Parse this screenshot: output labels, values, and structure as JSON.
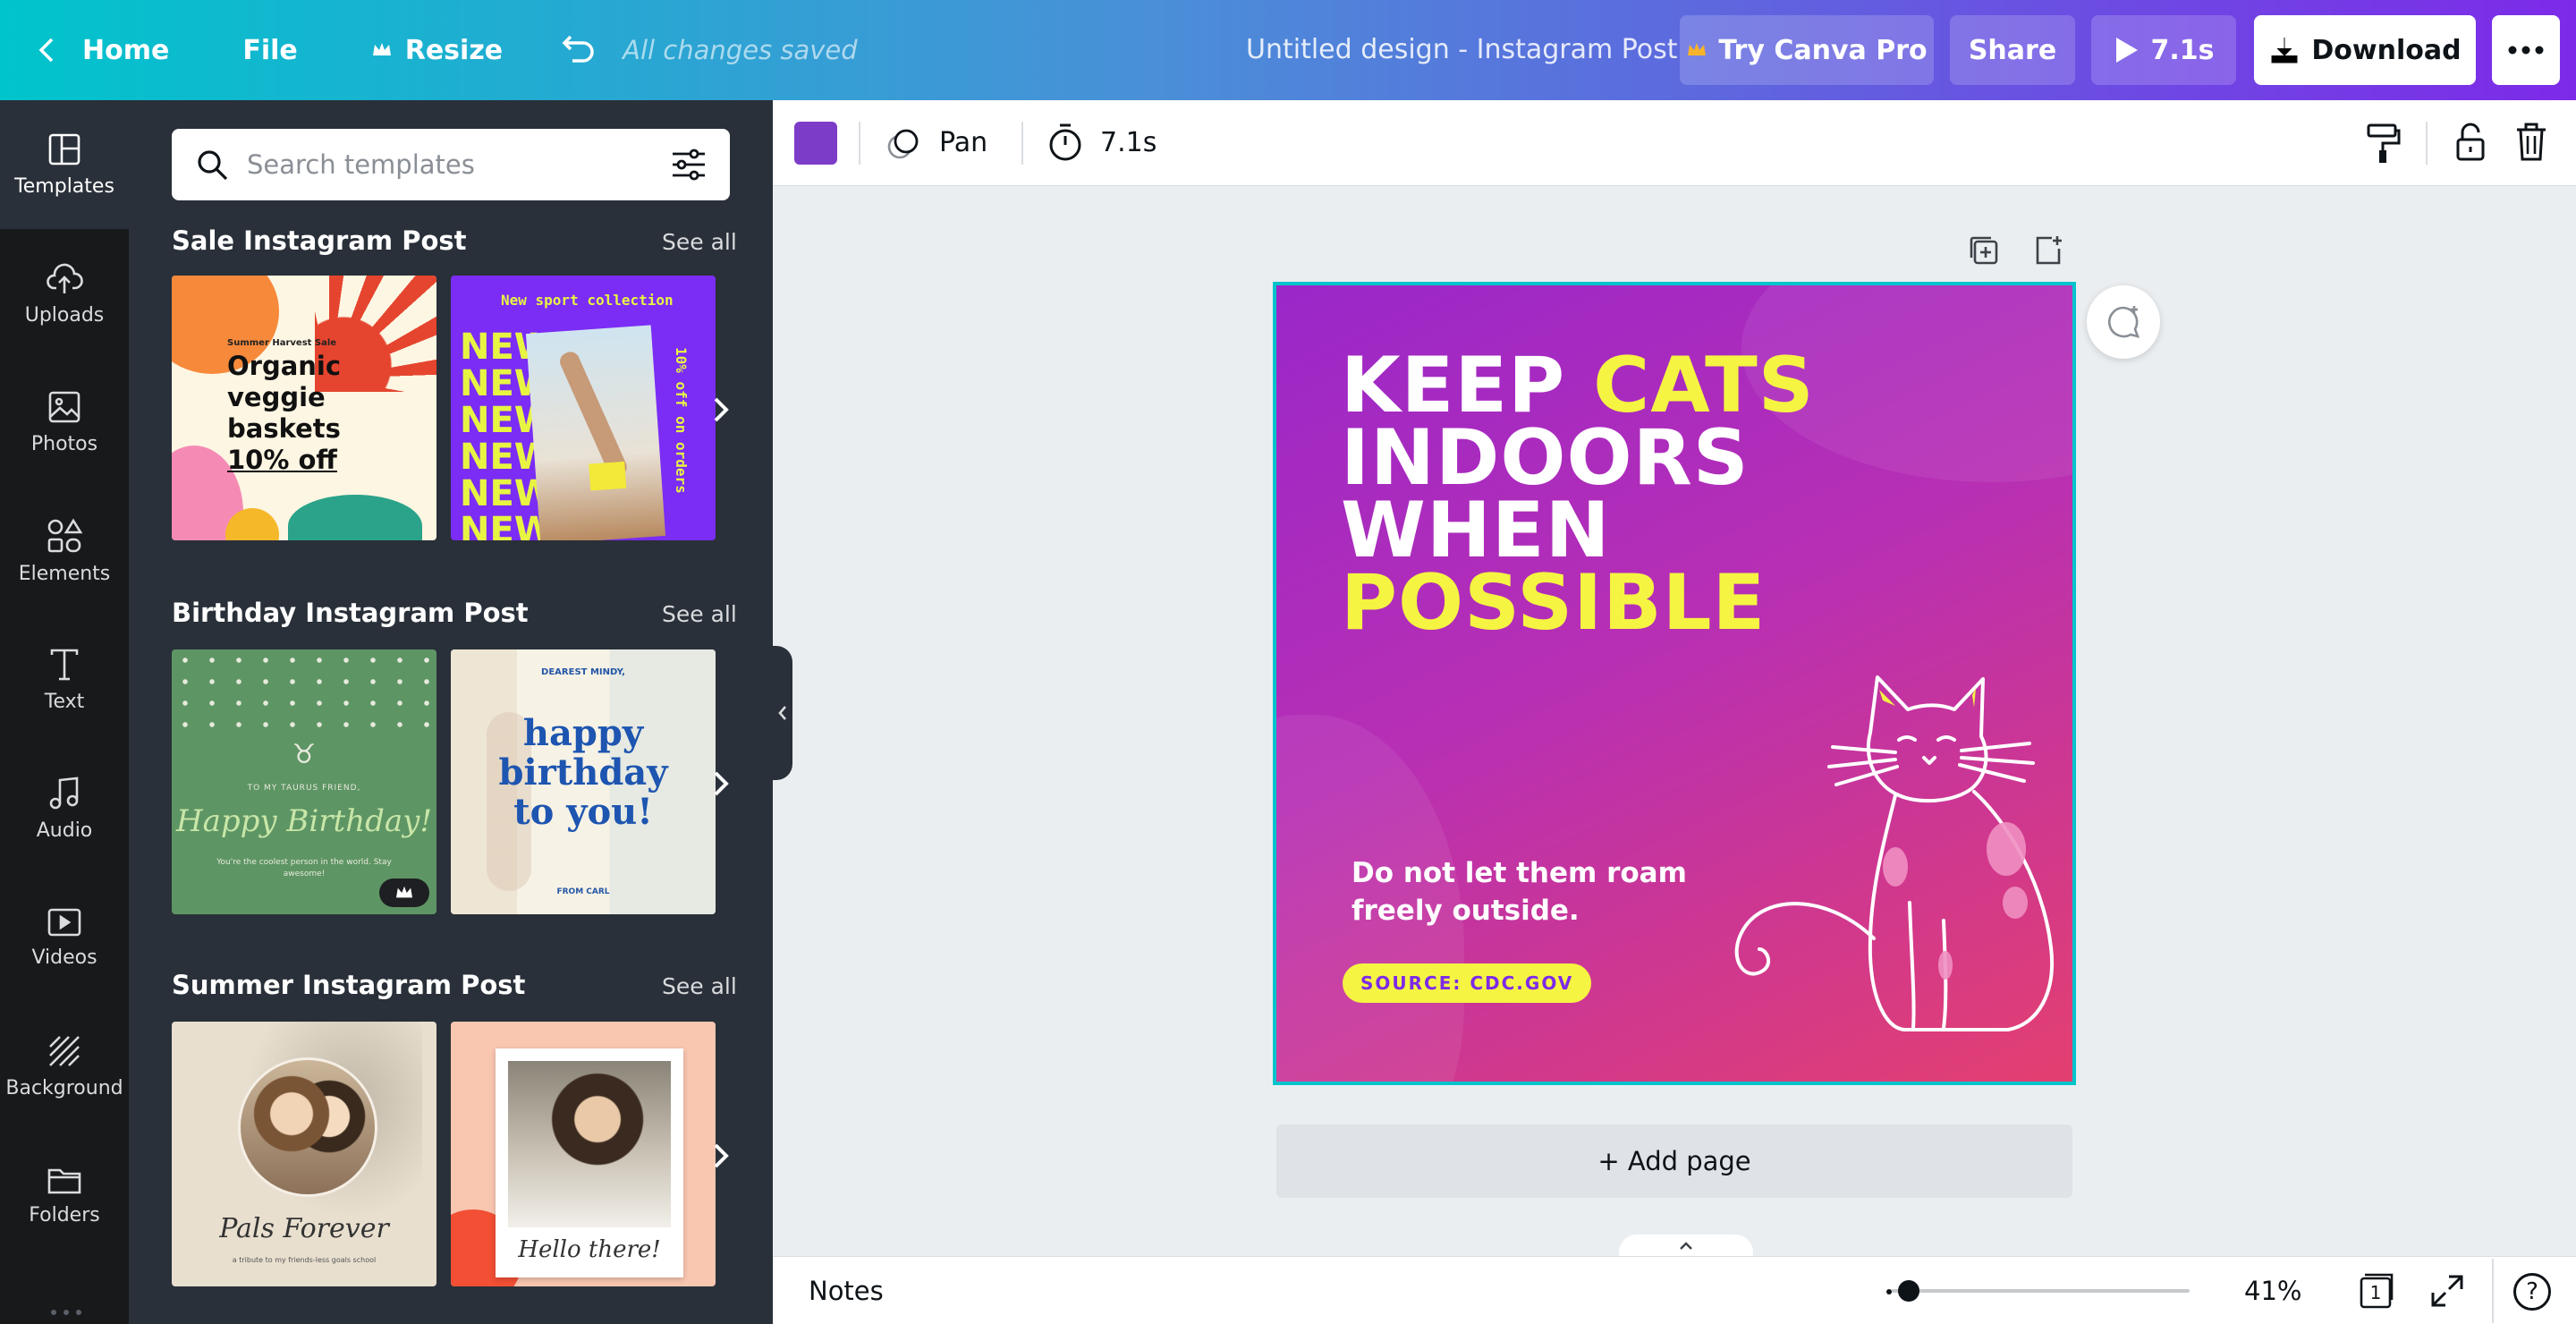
{
  "topbar": {
    "home": "Home",
    "file": "File",
    "resize": "Resize",
    "saved_status": "All changes saved",
    "doc_title": "Untitled design - Instagram Post",
    "try_pro": "Try Canva Pro",
    "share": "Share",
    "play_duration": "7.1s",
    "download": "Download"
  },
  "rail": {
    "items": [
      {
        "label": "Templates",
        "icon": "templates-icon"
      },
      {
        "label": "Uploads",
        "icon": "upload-cloud-icon"
      },
      {
        "label": "Photos",
        "icon": "image-icon"
      },
      {
        "label": "Elements",
        "icon": "shapes-icon"
      },
      {
        "label": "Text",
        "icon": "text-icon"
      },
      {
        "label": "Audio",
        "icon": "music-note-icon"
      },
      {
        "label": "Videos",
        "icon": "video-icon"
      },
      {
        "label": "Background",
        "icon": "background-icon"
      },
      {
        "label": "Folders",
        "icon": "folder-icon"
      }
    ]
  },
  "panel": {
    "search_placeholder": "Search templates",
    "sections": [
      {
        "title": "Sale Instagram Post",
        "see_all": "See all",
        "thumb1": {
          "small": "Summer Harvest Sale",
          "l1": "Organic",
          "l2": "veggie",
          "l3": "baskets",
          "l4": "10% off"
        },
        "thumb2": {
          "top": "New sport collection",
          "word": "NEW",
          "side": "10% off on orders"
        }
      },
      {
        "title": "Birthday Instagram Post",
        "see_all": "See all",
        "thumb1": {
          "small": "TO MY TAURUS FRIEND,",
          "script": "Happy Birthday!",
          "foot": "You're the coolest person in the world. Stay awesome!"
        },
        "thumb2": {
          "top": "DEAREST MINDY,",
          "l1": "happy",
          "l2": "birthday",
          "l3": "to you!",
          "foot": "FROM CARL"
        }
      },
      {
        "title": "Summer Instagram Post",
        "see_all": "See all",
        "thumb1": {
          "script": "Pals Forever",
          "foot": "a tribute to my friends-less goals school"
        },
        "thumb2": {
          "script": "Hello there!"
        }
      }
    ]
  },
  "toolbar": {
    "color": "#7d3cc8",
    "pan": "Pan",
    "timing": "7.1s"
  },
  "design": {
    "line1_white": "KEEP",
    "line1_yellow": "CATS",
    "line2": "INDOORS",
    "line3": "WHEN",
    "line4": "POSSIBLE",
    "subtext": "Do not let them roam freely outside.",
    "source": "SOURCE: CDC.GOV"
  },
  "add_page": "+ Add page",
  "footer": {
    "notes": "Notes",
    "zoom": "41%",
    "page_count": "1",
    "help": "?"
  }
}
